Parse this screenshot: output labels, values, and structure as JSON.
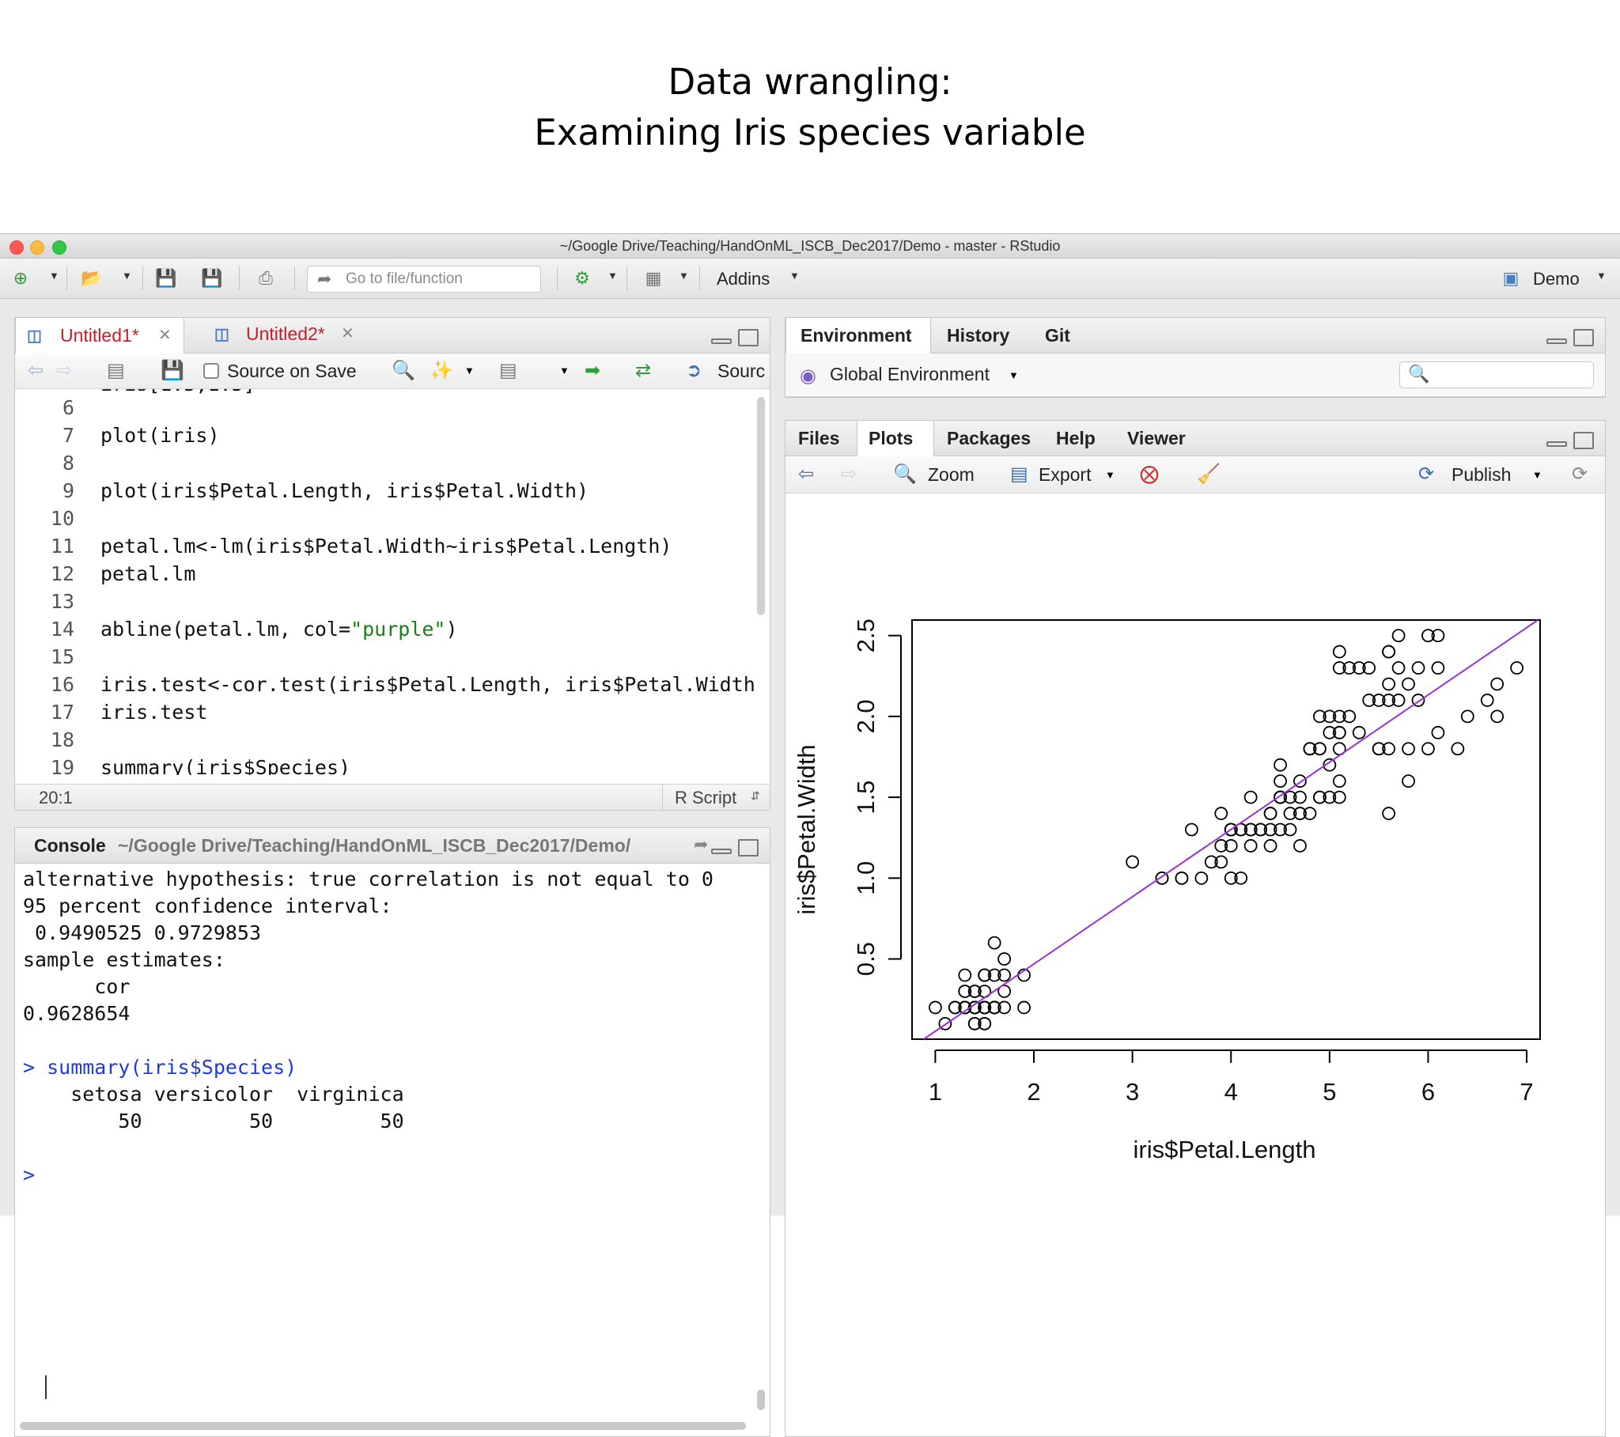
{
  "slide": {
    "title_line1": "Data wrangling:",
    "title_line2": "Examining Iris species variable"
  },
  "window": {
    "title": "~/Google Drive/Teaching/HandOnML_ISCB_Dec2017/Demo - master - RStudio"
  },
  "toolbar": {
    "goto_placeholder": "Go to file/function",
    "addins_label": "Addins",
    "project_label": "Demo"
  },
  "editor": {
    "tabs": [
      {
        "label": "Untitled1*"
      },
      {
        "label": "Untitled2*"
      }
    ],
    "source_on_save": "Source on Save",
    "source_label": "Sourc",
    "status_position": "20:1",
    "status_type": "R Script",
    "lines": [
      {
        "n": "6",
        "code": ""
      },
      {
        "n": "7",
        "code": "plot(iris)"
      },
      {
        "n": "8",
        "code": ""
      },
      {
        "n": "9",
        "code": "plot(iris$Petal.Length, iris$Petal.Width)"
      },
      {
        "n": "10",
        "code": ""
      },
      {
        "n": "11",
        "code": "petal.lm<-lm(iris$Petal.Width~iris$Petal.Length)"
      },
      {
        "n": "12",
        "code": "petal.lm"
      },
      {
        "n": "13",
        "code": ""
      },
      {
        "n": "14",
        "code_a": "abline(petal.lm, col=",
        "code_str": "\"purple\"",
        "code_b": ")"
      },
      {
        "n": "15",
        "code": ""
      },
      {
        "n": "16",
        "code": "iris.test<-cor.test(iris$Petal.Length, iris$Petal.Width)"
      },
      {
        "n": "17",
        "code": "iris.test"
      },
      {
        "n": "18",
        "code": ""
      },
      {
        "n": "19",
        "code": "summary(iris$Species)"
      }
    ]
  },
  "console": {
    "title": "Console",
    "path": "~/Google Drive/Teaching/HandOnML_ISCB_Dec2017/Demo/",
    "lines": [
      {
        "text": "alternative hypothesis: true correlation is not equal to 0",
        "cls": ""
      },
      {
        "text": "95 percent confidence interval:",
        "cls": ""
      },
      {
        "text": " 0.9490525 0.9729853",
        "cls": ""
      },
      {
        "text": "sample estimates:",
        "cls": ""
      },
      {
        "text": "      cor",
        "cls": ""
      },
      {
        "text": "0.9628654",
        "cls": ""
      },
      {
        "text": "",
        "cls": ""
      },
      {
        "text": "> summary(iris$Species)",
        "cls": "con-blue"
      },
      {
        "text": "    setosa versicolor  virginica",
        "cls": ""
      },
      {
        "text": "        50         50         50",
        "cls": ""
      },
      {
        "text": "",
        "cls": ""
      },
      {
        "text": ">",
        "cls": "con-blue"
      }
    ]
  },
  "environment": {
    "tabs": [
      "Environment",
      "History",
      "Git"
    ],
    "scope_label": "Global Environment"
  },
  "files": {
    "tabs": [
      "Files",
      "Plots",
      "Packages",
      "Help",
      "Viewer"
    ],
    "zoom_label": "Zoom",
    "export_label": "Export",
    "publish_label": "Publish"
  },
  "colors": {
    "regression_line": "#9b30d9",
    "highlight": "#f3962f",
    "active_tab_text": "#c0202b"
  },
  "chart_data": {
    "type": "scatter",
    "title": "",
    "xlabel": "iris$Petal.Length",
    "ylabel": "iris$Petal.Width",
    "xlim": [
      1.0,
      6.9
    ],
    "ylim": [
      0.1,
      2.5
    ],
    "x_ticks": [
      "1",
      "2",
      "3",
      "4",
      "5",
      "6",
      "7"
    ],
    "y_ticks": [
      "0.5",
      "1.0",
      "1.5",
      "2.0",
      "2.5"
    ],
    "x_tick_values": [
      1,
      2,
      3,
      4,
      5,
      6,
      7
    ],
    "y_tick_values": [
      0.5,
      1.0,
      1.5,
      2.0,
      2.5
    ],
    "regression": {
      "intercept": -0.363,
      "slope": 0.416
    },
    "x": [
      1.4,
      1.4,
      1.3,
      1.5,
      1.4,
      1.7,
      1.4,
      1.5,
      1.4,
      1.5,
      1.5,
      1.6,
      1.4,
      1.1,
      1.2,
      1.5,
      1.3,
      1.4,
      1.7,
      1.5,
      1.7,
      1.5,
      1.0,
      1.7,
      1.9,
      1.6,
      1.6,
      1.5,
      1.4,
      1.6,
      1.6,
      1.5,
      1.5,
      1.4,
      1.5,
      1.2,
      1.3,
      1.4,
      1.3,
      1.5,
      1.3,
      1.3,
      1.3,
      1.6,
      1.9,
      1.4,
      1.6,
      1.4,
      1.5,
      1.4,
      4.7,
      4.5,
      4.9,
      4.0,
      4.6,
      4.5,
      4.7,
      3.3,
      4.6,
      3.9,
      3.5,
      4.2,
      4.0,
      4.7,
      3.6,
      4.4,
      4.5,
      4.1,
      4.5,
      3.9,
      4.8,
      4.0,
      4.9,
      4.7,
      4.3,
      4.4,
      4.8,
      5.0,
      4.5,
      3.5,
      3.8,
      3.7,
      3.9,
      5.1,
      4.5,
      4.5,
      4.7,
      4.4,
      4.1,
      4.0,
      4.4,
      4.6,
      4.0,
      3.3,
      4.2,
      4.2,
      4.2,
      4.3,
      3.0,
      4.1,
      6.0,
      5.1,
      5.9,
      5.6,
      5.8,
      6.6,
      4.5,
      6.3,
      5.8,
      6.1,
      5.1,
      5.3,
      5.5,
      5.0,
      5.1,
      5.3,
      5.5,
      6.7,
      6.9,
      5.0,
      5.7,
      4.9,
      6.7,
      4.9,
      5.7,
      6.0,
      4.8,
      4.9,
      5.6,
      5.8,
      6.1,
      6.4,
      5.6,
      5.1,
      5.6,
      6.1,
      5.6,
      5.5,
      4.8,
      5.4,
      5.6,
      5.1,
      5.1,
      5.9,
      5.7,
      5.2,
      5.0,
      5.2,
      5.4,
      5.1
    ],
    "y": [
      0.2,
      0.2,
      0.2,
      0.2,
      0.2,
      0.4,
      0.3,
      0.2,
      0.2,
      0.1,
      0.2,
      0.2,
      0.1,
      0.1,
      0.2,
      0.4,
      0.4,
      0.3,
      0.3,
      0.3,
      0.2,
      0.4,
      0.2,
      0.5,
      0.2,
      0.2,
      0.4,
      0.2,
      0.2,
      0.2,
      0.2,
      0.4,
      0.1,
      0.2,
      0.2,
      0.2,
      0.2,
      0.1,
      0.2,
      0.2,
      0.3,
      0.3,
      0.2,
      0.6,
      0.4,
      0.3,
      0.2,
      0.2,
      0.2,
      0.2,
      1.4,
      1.5,
      1.5,
      1.3,
      1.5,
      1.3,
      1.6,
      1.0,
      1.3,
      1.4,
      1.0,
      1.5,
      1.0,
      1.4,
      1.3,
      1.4,
      1.5,
      1.0,
      1.5,
      1.1,
      1.8,
      1.3,
      1.5,
      1.2,
      1.3,
      1.4,
      1.4,
      1.7,
      1.5,
      1.0,
      1.1,
      1.0,
      1.2,
      1.6,
      1.5,
      1.6,
      1.5,
      1.3,
      1.3,
      1.3,
      1.2,
      1.4,
      1.2,
      1.0,
      1.3,
      1.2,
      1.3,
      1.3,
      1.1,
      1.3,
      2.5,
      1.9,
      2.1,
      1.8,
      2.2,
      2.1,
      1.7,
      1.8,
      1.8,
      2.5,
      2.0,
      1.9,
      2.1,
      2.0,
      2.4,
      2.3,
      1.8,
      2.2,
      2.3,
      1.5,
      2.3,
      2.0,
      2.0,
      1.8,
      2.1,
      1.8,
      1.8,
      1.8,
      2.1,
      1.6,
      1.9,
      2.0,
      2.2,
      1.5,
      1.4,
      2.3,
      2.4,
      1.8,
      1.8,
      2.1,
      2.4,
      2.3,
      1.9,
      2.3,
      2.5,
      2.3,
      1.9,
      2.0,
      2.3,
      1.8
    ]
  }
}
